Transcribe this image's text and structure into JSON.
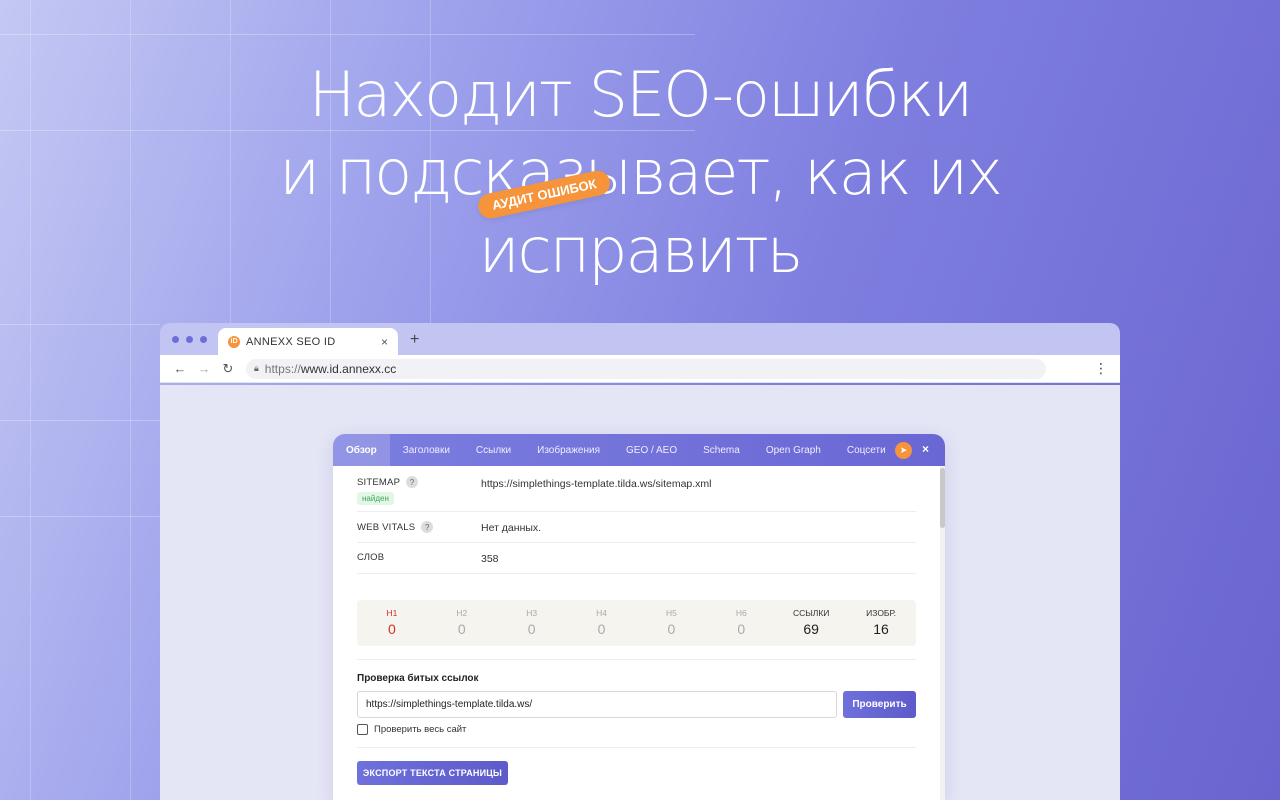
{
  "hero": {
    "line1": "Находит SEO-ошибки",
    "line2": "и подсказывает, как их",
    "line3": "исправить",
    "badge": "АУДИТ ОШИБОК"
  },
  "browser": {
    "tab_title": "ANNEXX SEO ID",
    "favicon_letter": "iD",
    "new_tab": "+",
    "tab_close": "×",
    "url_scheme": "https://",
    "url_host": "www.id.annexx.cc"
  },
  "popup": {
    "tabs": [
      {
        "label": "Обзор",
        "active": true
      },
      {
        "label": "Заголовки"
      },
      {
        "label": "Ссылки"
      },
      {
        "label": "Изображения"
      },
      {
        "label": "GEO / AEO"
      },
      {
        "label": "Schema"
      },
      {
        "label": "Open Graph"
      },
      {
        "label": "Соцсети"
      }
    ],
    "close": "×",
    "sitemap": {
      "label": "SITEMAP",
      "help": "?",
      "status": "найден",
      "value": "https://simplethings-template.tilda.ws/sitemap.xml"
    },
    "web_vitals": {
      "label": "WEB VITALS",
      "help": "?",
      "value": "Нет данных."
    },
    "words": {
      "label": "СЛОВ",
      "value": "358"
    },
    "stats": [
      {
        "label": "H1",
        "value": "0"
      },
      {
        "label": "H2",
        "value": "0"
      },
      {
        "label": "H3",
        "value": "0"
      },
      {
        "label": "H4",
        "value": "0"
      },
      {
        "label": "H5",
        "value": "0"
      },
      {
        "label": "H6",
        "value": "0"
      },
      {
        "label": "ССЫЛКИ",
        "value": "69"
      },
      {
        "label": "ИЗОБР.",
        "value": "16"
      }
    ],
    "broken_links": {
      "title": "Проверка битых ссылок",
      "input_value": "https://simplethings-template.tilda.ws/",
      "button": "Проверить",
      "whole_site": "Проверить весь сайт"
    },
    "export_button": "ЭКСПОРТ ТЕКСТА СТРАНИЦЫ"
  },
  "colors": {
    "accent": "#6e70dc",
    "orange": "#f5943a",
    "h1_red": "#d0302b",
    "found_green": "#3aa85a"
  }
}
